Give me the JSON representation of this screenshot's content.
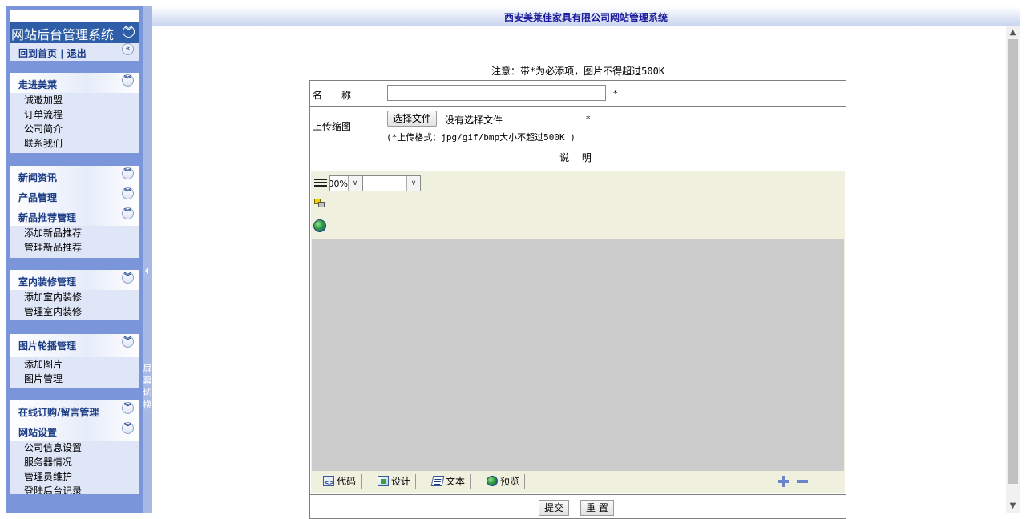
{
  "top_bar": {
    "title": "西安美莱佳家具有限公司网站管理系统"
  },
  "nav": {
    "brand": "网站后台管理系统",
    "home_links": "回到首页 | 退出",
    "switch_label": "屏幕切换",
    "groups": [
      {
        "title": "走进美莱",
        "items": [
          "诚邀加盟",
          "订单流程",
          "公司简介",
          "联系我们"
        ]
      },
      {
        "title": "新闻资讯",
        "items": []
      },
      {
        "title": "产品管理",
        "items": []
      },
      {
        "title": "新品推荐管理",
        "items": [
          "添加新品推荐",
          "管理新品推荐"
        ]
      },
      {
        "title": "室内装修管理",
        "items": [
          "添加室内装修",
          "管理室内装修"
        ]
      },
      {
        "title": "图片轮播管理",
        "items": [
          "添加图片",
          "图片管理"
        ]
      },
      {
        "title": "在线订购/留言管理",
        "items": []
      },
      {
        "title": "网站设置",
        "items": [
          "公司信息设置",
          "服务器情况",
          "管理员维护",
          "登陆后台记录"
        ]
      }
    ]
  },
  "form": {
    "notice": "注意：带*为必添项，图片不得超过500K",
    "name_label": "名　　称",
    "name_value": "",
    "required_mark": "*",
    "thumb_label": "上传缩图",
    "file_button": "选择文件",
    "file_status": "没有选择文件",
    "upload_hint": "(*上传格式：jpg/gif/bmp大小不超过500K )",
    "desc_label": "说 明",
    "submit": "提交",
    "reset": "重 置"
  },
  "editor": {
    "zoom_value": "100%",
    "font_value": "",
    "modes": [
      "代码",
      "设计",
      "文本",
      "预览"
    ]
  },
  "icons": [
    "align-icon",
    "background-color-icon",
    "globe-icon",
    "code-icon",
    "design-icon",
    "text-icon",
    "preview-icon",
    "enlarge-icon",
    "shrink-icon"
  ]
}
